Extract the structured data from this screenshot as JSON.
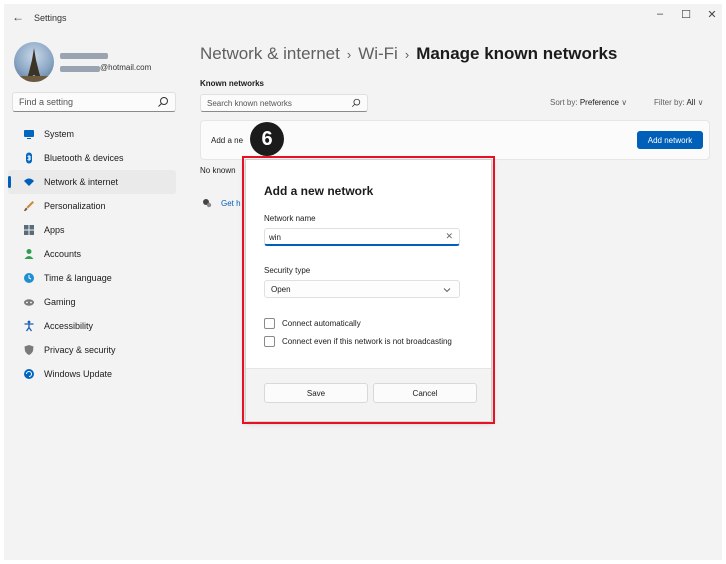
{
  "window": {
    "app_title": "Settings",
    "back_glyph": "←",
    "controls": {
      "minimize": "–",
      "maximize": "☐",
      "close": "✕"
    }
  },
  "profile": {
    "email": "@hotmail.com"
  },
  "search": {
    "placeholder": "Find a setting",
    "icon": "search-icon"
  },
  "sidebar": {
    "items": [
      {
        "label": "System",
        "icon": "monitor-icon",
        "color": "#0067c0"
      },
      {
        "label": "Bluetooth & devices",
        "icon": "bluetooth-icon",
        "color": "#0067c0"
      },
      {
        "label": "Network & internet",
        "icon": "wifi-icon",
        "color": "#005fb8",
        "active": true
      },
      {
        "label": "Personalization",
        "icon": "brush-icon",
        "color": "#d08a3a"
      },
      {
        "label": "Apps",
        "icon": "apps-icon",
        "color": "#5a6b7a"
      },
      {
        "label": "Accounts",
        "icon": "person-icon",
        "color": "#2f9e52"
      },
      {
        "label": "Time & language",
        "icon": "globe-clock-icon",
        "color": "#1f8fd1"
      },
      {
        "label": "Gaming",
        "icon": "gamepad-icon",
        "color": "#7a7a7a"
      },
      {
        "label": "Accessibility",
        "icon": "accessibility-icon",
        "color": "#1a5fb4"
      },
      {
        "label": "Privacy & security",
        "icon": "shield-icon",
        "color": "#7a7a7a"
      },
      {
        "label": "Windows Update",
        "icon": "update-icon",
        "color": "#0067c0"
      }
    ]
  },
  "header": {
    "crumbs": [
      "Network & internet",
      "Wi-Fi"
    ],
    "separator": "›",
    "current": "Manage known networks"
  },
  "known": {
    "section_label": "Known networks",
    "search_placeholder": "Search known networks",
    "sort_label": "Sort by:",
    "sort_value": "Preference",
    "filter_label": "Filter by:",
    "filter_value": "All",
    "dropdown_glyph": "∨",
    "add_label": "Add a ne",
    "add_button": "Add network",
    "empty_text": "No known",
    "help_text": "Get h"
  },
  "step_badge": "6",
  "dialog": {
    "title": "Add a new network",
    "name_label": "Network name",
    "name_value": "win",
    "clear_glyph": "✕",
    "security_label": "Security type",
    "security_value": "Open",
    "connect_auto": "Connect automatically",
    "connect_hidden": "Connect even if this network is not broadcasting",
    "save": "Save",
    "cancel": "Cancel"
  },
  "colors": {
    "accent": "#005fb8",
    "highlight": "#e81123"
  }
}
